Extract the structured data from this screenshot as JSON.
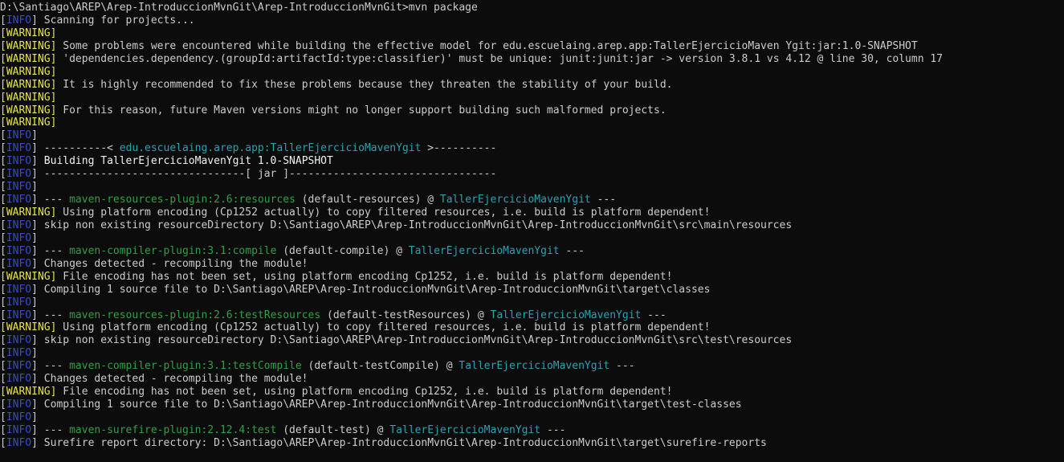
{
  "console": {
    "lines": [
      [
        {
          "t": "D:\\Santiago\\AREP\\Arep-IntroduccionMvnGit\\Arep-IntroduccionMvnGit>mvn package",
          "c": "text"
        }
      ],
      [
        {
          "t": "[",
          "c": "text"
        },
        {
          "t": "INFO",
          "c": "info"
        },
        {
          "t": "] Scanning for projects...",
          "c": "text"
        }
      ],
      [
        {
          "t": "[WARNING]",
          "c": "warn"
        }
      ],
      [
        {
          "t": "[WARNING]",
          "c": "warn"
        },
        {
          "t": " Some problems were encountered while building the effective model for edu.escuelaing.arep.app:TallerEjercicioMaven Ygit:jar:1.0-SNAPSHOT",
          "c": "text"
        }
      ],
      [
        {
          "t": "[WARNING]",
          "c": "warn"
        },
        {
          "t": " 'dependencies.dependency.(groupId:artifactId:type:classifier)' must be unique: junit:junit:jar -> version 3.8.1 vs 4.12 @ line 30, column 17",
          "c": "text"
        }
      ],
      [
        {
          "t": "[WARNING]",
          "c": "warn"
        }
      ],
      [
        {
          "t": "[WARNING]",
          "c": "warn"
        },
        {
          "t": " It is highly recommended to fix these problems because they threaten the stability of your build.",
          "c": "text"
        }
      ],
      [
        {
          "t": "[WARNING]",
          "c": "warn"
        }
      ],
      [
        {
          "t": "[WARNING]",
          "c": "warn"
        },
        {
          "t": " For this reason, future Maven versions might no longer support building such malformed projects.",
          "c": "text"
        }
      ],
      [
        {
          "t": "[WARNING]",
          "c": "warn"
        }
      ],
      [
        {
          "t": "[",
          "c": "text"
        },
        {
          "t": "INFO",
          "c": "info"
        },
        {
          "t": "]",
          "c": "text"
        }
      ],
      [
        {
          "t": "[",
          "c": "text"
        },
        {
          "t": "INFO",
          "c": "info"
        },
        {
          "t": "] ----------< ",
          "c": "text"
        },
        {
          "t": "edu.escuelaing.arep.app:TallerEjercicioMavenYgit",
          "c": "project"
        },
        {
          "t": " >----------",
          "c": "text"
        }
      ],
      [
        {
          "t": "[",
          "c": "text"
        },
        {
          "t": "INFO",
          "c": "info"
        },
        {
          "t": "] ",
          "c": "text"
        },
        {
          "t": "Building TallerEjercicioMavenYgit 1.0-SNAPSHOT",
          "c": "bright"
        }
      ],
      [
        {
          "t": "[",
          "c": "text"
        },
        {
          "t": "INFO",
          "c": "info"
        },
        {
          "t": "] --------------------------------[ jar ]---------------------------------",
          "c": "text"
        }
      ],
      [
        {
          "t": "[",
          "c": "text"
        },
        {
          "t": "INFO",
          "c": "info"
        },
        {
          "t": "]",
          "c": "text"
        }
      ],
      [
        {
          "t": "[",
          "c": "text"
        },
        {
          "t": "INFO",
          "c": "info"
        },
        {
          "t": "] --- ",
          "c": "text"
        },
        {
          "t": "maven-resources-plugin:2.6:resources",
          "c": "plugin"
        },
        {
          "t": " (default-resources) @ ",
          "c": "text"
        },
        {
          "t": "TallerEjercicioMavenYgit",
          "c": "project"
        },
        {
          "t": " ---",
          "c": "text"
        }
      ],
      [
        {
          "t": "[WARNING]",
          "c": "warn"
        },
        {
          "t": " Using platform encoding (Cp1252 actually) to copy filtered resources, i.e. build is platform dependent!",
          "c": "text"
        }
      ],
      [
        {
          "t": "[",
          "c": "text"
        },
        {
          "t": "INFO",
          "c": "info"
        },
        {
          "t": "] skip non existing resourceDirectory D:\\Santiago\\AREP\\Arep-IntroduccionMvnGit\\Arep-IntroduccionMvnGit\\src\\main\\resources",
          "c": "text"
        }
      ],
      [
        {
          "t": "[",
          "c": "text"
        },
        {
          "t": "INFO",
          "c": "info"
        },
        {
          "t": "]",
          "c": "text"
        }
      ],
      [
        {
          "t": "[",
          "c": "text"
        },
        {
          "t": "INFO",
          "c": "info"
        },
        {
          "t": "] --- ",
          "c": "text"
        },
        {
          "t": "maven-compiler-plugin:3.1:compile",
          "c": "plugin"
        },
        {
          "t": " (default-compile) @ ",
          "c": "text"
        },
        {
          "t": "TallerEjercicioMavenYgit",
          "c": "project"
        },
        {
          "t": " ---",
          "c": "text"
        }
      ],
      [
        {
          "t": "[",
          "c": "text"
        },
        {
          "t": "INFO",
          "c": "info"
        },
        {
          "t": "] Changes detected - recompiling the module!",
          "c": "text"
        }
      ],
      [
        {
          "t": "[WARNING]",
          "c": "warn"
        },
        {
          "t": " File encoding has not been set, using platform encoding Cp1252, i.e. build is platform dependent!",
          "c": "text"
        }
      ],
      [
        {
          "t": "[",
          "c": "text"
        },
        {
          "t": "INFO",
          "c": "info"
        },
        {
          "t": "] Compiling 1 source file to D:\\Santiago\\AREP\\Arep-IntroduccionMvnGit\\Arep-IntroduccionMvnGit\\target\\classes",
          "c": "text"
        }
      ],
      [
        {
          "t": "[",
          "c": "text"
        },
        {
          "t": "INFO",
          "c": "info"
        },
        {
          "t": "]",
          "c": "text"
        }
      ],
      [
        {
          "t": "[",
          "c": "text"
        },
        {
          "t": "INFO",
          "c": "info"
        },
        {
          "t": "] --- ",
          "c": "text"
        },
        {
          "t": "maven-resources-plugin:2.6:testResources",
          "c": "plugin"
        },
        {
          "t": " (default-testResources) @ ",
          "c": "text"
        },
        {
          "t": "TallerEjercicioMavenYgit",
          "c": "project"
        },
        {
          "t": " ---",
          "c": "text"
        }
      ],
      [
        {
          "t": "[WARNING]",
          "c": "warn"
        },
        {
          "t": " Using platform encoding (Cp1252 actually) to copy filtered resources, i.e. build is platform dependent!",
          "c": "text"
        }
      ],
      [
        {
          "t": "[",
          "c": "text"
        },
        {
          "t": "INFO",
          "c": "info"
        },
        {
          "t": "] skip non existing resourceDirectory D:\\Santiago\\AREP\\Arep-IntroduccionMvnGit\\Arep-IntroduccionMvnGit\\src\\test\\resources",
          "c": "text"
        }
      ],
      [
        {
          "t": "[",
          "c": "text"
        },
        {
          "t": "INFO",
          "c": "info"
        },
        {
          "t": "]",
          "c": "text"
        }
      ],
      [
        {
          "t": "[",
          "c": "text"
        },
        {
          "t": "INFO",
          "c": "info"
        },
        {
          "t": "] --- ",
          "c": "text"
        },
        {
          "t": "maven-compiler-plugin:3.1:testCompile",
          "c": "plugin"
        },
        {
          "t": " (default-testCompile) @ ",
          "c": "text"
        },
        {
          "t": "TallerEjercicioMavenYgit",
          "c": "project"
        },
        {
          "t": " ---",
          "c": "text"
        }
      ],
      [
        {
          "t": "[",
          "c": "text"
        },
        {
          "t": "INFO",
          "c": "info"
        },
        {
          "t": "] Changes detected - recompiling the module!",
          "c": "text"
        }
      ],
      [
        {
          "t": "[WARNING]",
          "c": "warn"
        },
        {
          "t": " File encoding has not been set, using platform encoding Cp1252, i.e. build is platform dependent!",
          "c": "text"
        }
      ],
      [
        {
          "t": "[",
          "c": "text"
        },
        {
          "t": "INFO",
          "c": "info"
        },
        {
          "t": "] Compiling 1 source file to D:\\Santiago\\AREP\\Arep-IntroduccionMvnGit\\Arep-IntroduccionMvnGit\\target\\test-classes",
          "c": "text"
        }
      ],
      [
        {
          "t": "[",
          "c": "text"
        },
        {
          "t": "INFO",
          "c": "info"
        },
        {
          "t": "]",
          "c": "text"
        }
      ],
      [
        {
          "t": "[",
          "c": "text"
        },
        {
          "t": "INFO",
          "c": "info"
        },
        {
          "t": "] --- ",
          "c": "text"
        },
        {
          "t": "maven-surefire-plugin:2.12.4:test",
          "c": "plugin"
        },
        {
          "t": " (default-test) @ ",
          "c": "text"
        },
        {
          "t": "TallerEjercicioMavenYgit",
          "c": "project"
        },
        {
          "t": " ---",
          "c": "text"
        }
      ],
      [
        {
          "t": "[",
          "c": "text"
        },
        {
          "t": "INFO",
          "c": "info"
        },
        {
          "t": "] Surefire report directory: D:\\Santiago\\AREP\\Arep-IntroduccionMvnGit\\Arep-IntroduccionMvnGit\\target\\surefire-reports",
          "c": "text"
        }
      ]
    ]
  },
  "colors": {
    "background": "#0c0c0c",
    "text": "#cccccc",
    "info": "#3b48c9",
    "warning": "#e6e64c",
    "plugin": "#2ea043",
    "project": "#2aa1b3",
    "bright": "#f2f2f2"
  }
}
